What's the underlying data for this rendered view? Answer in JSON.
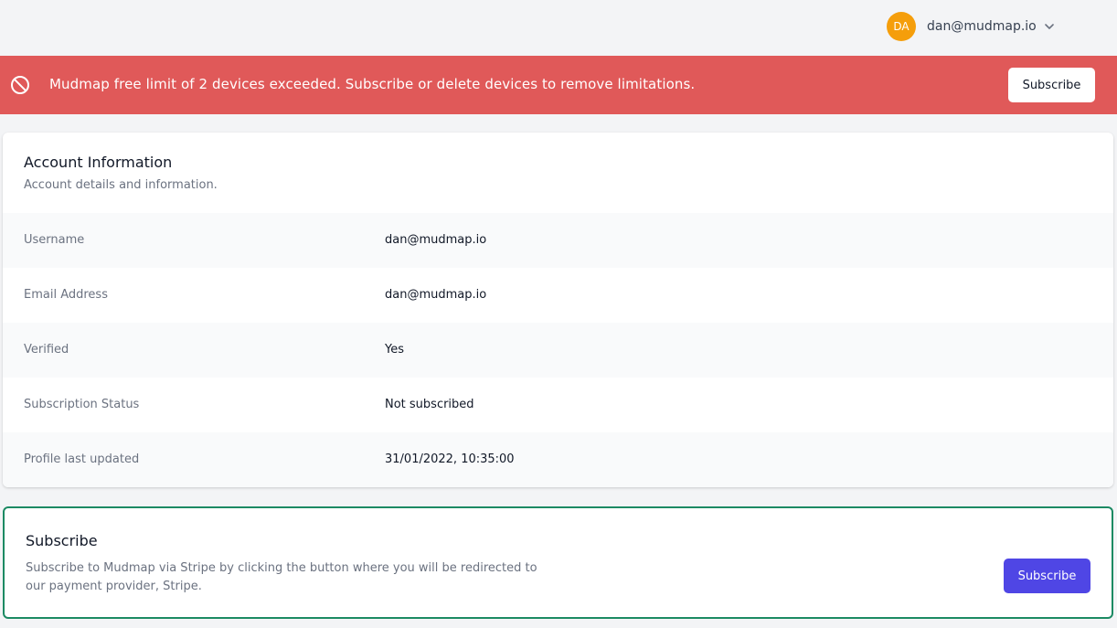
{
  "header": {
    "avatar_initials": "DA",
    "user_email": "dan@mudmap.io"
  },
  "alert": {
    "message": "Mudmap free limit of 2 devices exceeded. Subscribe or delete devices to remove limitations.",
    "button_label": "Subscribe",
    "color": "#e05959"
  },
  "account": {
    "title": "Account Information",
    "subtitle": "Account details and information.",
    "rows": [
      {
        "label": "Username",
        "value": "dan@mudmap.io"
      },
      {
        "label": "Email Address",
        "value": "dan@mudmap.io"
      },
      {
        "label": "Verified",
        "value": "Yes"
      },
      {
        "label": "Subscription Status",
        "value": "Not subscribed"
      },
      {
        "label": "Profile last updated",
        "value": "31/01/2022, 10:35:00"
      }
    ]
  },
  "subscribe": {
    "title": "Subscribe",
    "description": "Subscribe to Mudmap via Stripe by clicking the button where you will be redirected to our payment provider, Stripe.",
    "button_label": "Subscribe",
    "accent": "#4f46e5"
  },
  "icons": {
    "alert_icon": "prohibited-icon",
    "user_menu_icon": "chevron-down-icon"
  }
}
